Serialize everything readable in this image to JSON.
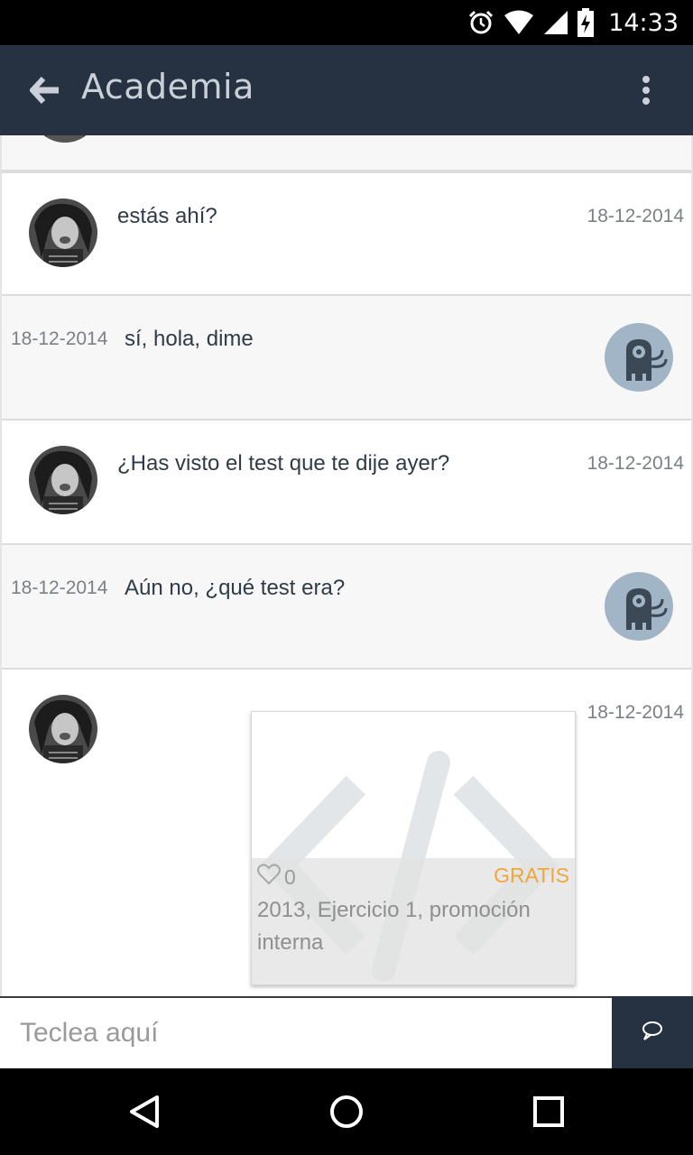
{
  "status_bar": {
    "time": "14:33",
    "icons": [
      "alarm-icon",
      "wifi-icon",
      "signal-icon",
      "battery-charging-icon"
    ]
  },
  "app_bar": {
    "title": "Academia",
    "back_icon": "arrow-left-icon",
    "menu_icon": "more-vert-icon"
  },
  "messages": [
    {
      "direction": "incoming",
      "text": "estás ahí?",
      "date": "18-12-2014"
    },
    {
      "direction": "outgoing",
      "text": "sí, hola, dime",
      "date": "18-12-2014"
    },
    {
      "direction": "incoming",
      "text": "¿Has visto el test que te dije ayer?",
      "date": "18-12-2014"
    },
    {
      "direction": "outgoing",
      "text": "Aún no, ¿qué test era?",
      "date": "18-12-2014"
    },
    {
      "direction": "incoming",
      "date": "18-12-2014",
      "attachment": {
        "likes": "0",
        "price": "GRATIS",
        "title": "2013, Ejercicio 1, promoción interna",
        "icon": "code-icon"
      }
    }
  ],
  "composer": {
    "placeholder": "Teclea aquí",
    "send_icon": "chat-bubble-icon"
  },
  "nav_bar": {
    "icons": [
      "back-triangle-icon",
      "home-circle-icon",
      "recents-square-icon"
    ]
  },
  "colors": {
    "app_bar": "#263241",
    "bot_avatar": "#a2b5c6",
    "price": "#f0a73a",
    "outgoing_bg": "#f7f7f7"
  }
}
